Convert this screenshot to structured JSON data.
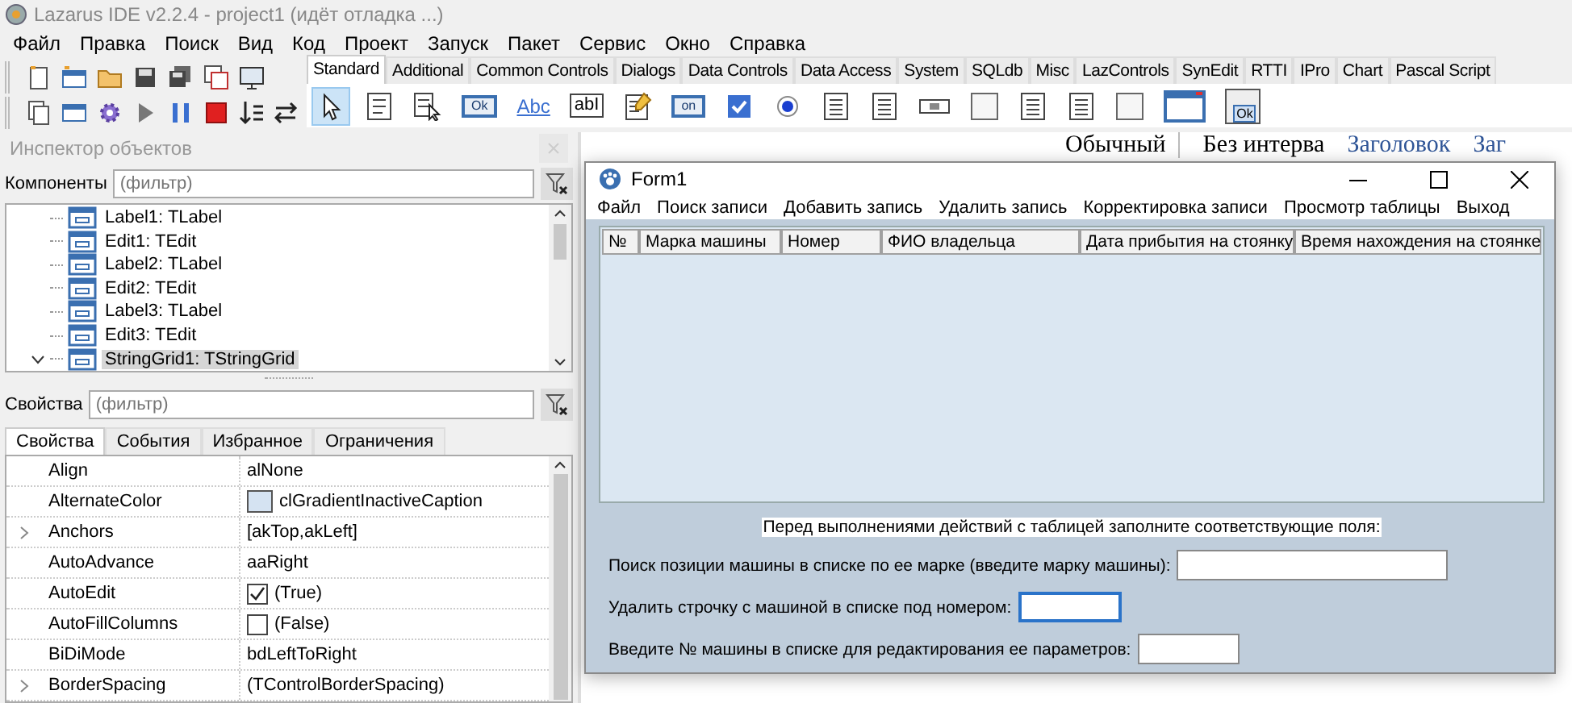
{
  "ide": {
    "title": "Lazarus IDE v2.2.4 - project1 (идёт отладка ...)",
    "menu": [
      "Файл",
      "Правка",
      "Поиск",
      "Вид",
      "Код",
      "Проект",
      "Запуск",
      "Пакет",
      "Сервис",
      "Окно",
      "Справка"
    ],
    "palette_tabs": [
      {
        "label": "Standard",
        "selected": true
      },
      {
        "label": "Additional",
        "selected": false
      },
      {
        "label": "Common Controls",
        "selected": false
      },
      {
        "label": "Dialogs",
        "selected": false
      },
      {
        "label": "Data Controls",
        "selected": false
      },
      {
        "label": "Data Access",
        "selected": false
      },
      {
        "label": "System",
        "selected": false
      },
      {
        "label": "SQLdb",
        "selected": false
      },
      {
        "label": "Misc",
        "selected": false
      },
      {
        "label": "LazControls",
        "selected": false
      },
      {
        "label": "SynEdit",
        "selected": false
      },
      {
        "label": "RTTI",
        "selected": false
      },
      {
        "label": "IPro",
        "selected": false
      },
      {
        "label": "Chart",
        "selected": false
      },
      {
        "label": "Pascal Script",
        "selected": false
      }
    ],
    "palette_icons": [
      {
        "kind": "pointer",
        "selected": true
      },
      {
        "kind": "menu",
        "selected": false
      },
      {
        "kind": "popup",
        "selected": false
      },
      {
        "kind": "button",
        "label": "Ok",
        "selected": false
      },
      {
        "kind": "label",
        "label": "Abc",
        "selected": false
      },
      {
        "kind": "edit",
        "label": "abI",
        "selected": false
      },
      {
        "kind": "memo",
        "selected": false
      },
      {
        "kind": "toggle",
        "label": "on",
        "selected": false
      },
      {
        "kind": "checkbox",
        "selected": false
      },
      {
        "kind": "radio",
        "selected": false
      },
      {
        "kind": "list",
        "selected": false
      },
      {
        "kind": "list",
        "selected": false
      },
      {
        "kind": "scrollbar",
        "selected": false
      },
      {
        "kind": "panel",
        "selected": false
      },
      {
        "kind": "list",
        "selected": false
      },
      {
        "kind": "list",
        "selected": false
      },
      {
        "kind": "panel",
        "selected": false
      },
      {
        "kind": "frame",
        "selected": false
      },
      {
        "kind": "actions",
        "label": "Ok",
        "selected": false
      }
    ]
  },
  "document_styles": [
    {
      "label": "Обычный",
      "color": "#000000"
    },
    {
      "label": "Без интерва",
      "color": "#000000"
    },
    {
      "label": "Заголовок",
      "color": "#2f5597"
    },
    {
      "label": "Заг",
      "color": "#2f5597"
    }
  ],
  "object_inspector": {
    "title": "Инспектор объектов",
    "components_label": "Компоненты",
    "components_placeholder": "(фильтр)",
    "tree": [
      {
        "label": "Label1: TLabel",
        "selected": false,
        "expanded": false
      },
      {
        "label": "Edit1: TEdit",
        "selected": false,
        "expanded": false
      },
      {
        "label": "Label2: TLabel",
        "selected": false,
        "expanded": false
      },
      {
        "label": "Edit2: TEdit",
        "selected": false,
        "expanded": false
      },
      {
        "label": "Label3: TLabel",
        "selected": false,
        "expanded": false
      },
      {
        "label": "Edit3: TEdit",
        "selected": false,
        "expanded": false
      },
      {
        "label": "StringGrid1: TStringGrid",
        "selected": true,
        "expanded": true
      }
    ],
    "properties_label": "Свойства",
    "properties_placeholder": "(фильтр)",
    "tabs": [
      {
        "label": "Свойства",
        "selected": true
      },
      {
        "label": "События",
        "selected": false
      },
      {
        "label": "Избранное",
        "selected": false
      },
      {
        "label": "Ограничения",
        "selected": false
      }
    ],
    "properties": [
      {
        "name": "Align",
        "value": "alNone",
        "kind": "text"
      },
      {
        "name": "AlternateColor",
        "value": "clGradientInactiveCaption",
        "kind": "color"
      },
      {
        "name": "Anchors",
        "value": "[akTop,akLeft]",
        "kind": "group"
      },
      {
        "name": "AutoAdvance",
        "value": "aaRight",
        "kind": "text"
      },
      {
        "name": "AutoEdit",
        "value": "(True)",
        "kind": "checkbox",
        "checked": true
      },
      {
        "name": "AutoFillColumns",
        "value": "(False)",
        "kind": "checkbox",
        "checked": false
      },
      {
        "name": "BiDiMode",
        "value": "bdLeftToRight",
        "kind": "text"
      },
      {
        "name": "BorderSpacing",
        "value": "(TControlBorderSpacing)",
        "kind": "group"
      }
    ]
  },
  "form": {
    "title": "Form1",
    "menu": [
      "Файл",
      "Поиск записи",
      "Добавить запись",
      "Удалить запись",
      "Корректировка записи",
      "Просмотр таблицы",
      "Выход"
    ],
    "grid": {
      "columns": [
        "№",
        "Марка машины",
        "Номер",
        "ФИО владельца",
        "Дата прибытия на стоянку",
        "Время нахождения на стоянке"
      ]
    },
    "notice": "Перед выполнениями действий с таблицей заполните соответствующие поля:",
    "fields": [
      {
        "label": "Поиск позиции машины в списке по ее марке (введите марку машины):",
        "focused": false
      },
      {
        "label": "Удалить строчку с машиной в списке под номером:",
        "focused": true
      },
      {
        "label": "Введите № машины в списке для редактирования ее параметров:",
        "focused": false
      }
    ]
  }
}
